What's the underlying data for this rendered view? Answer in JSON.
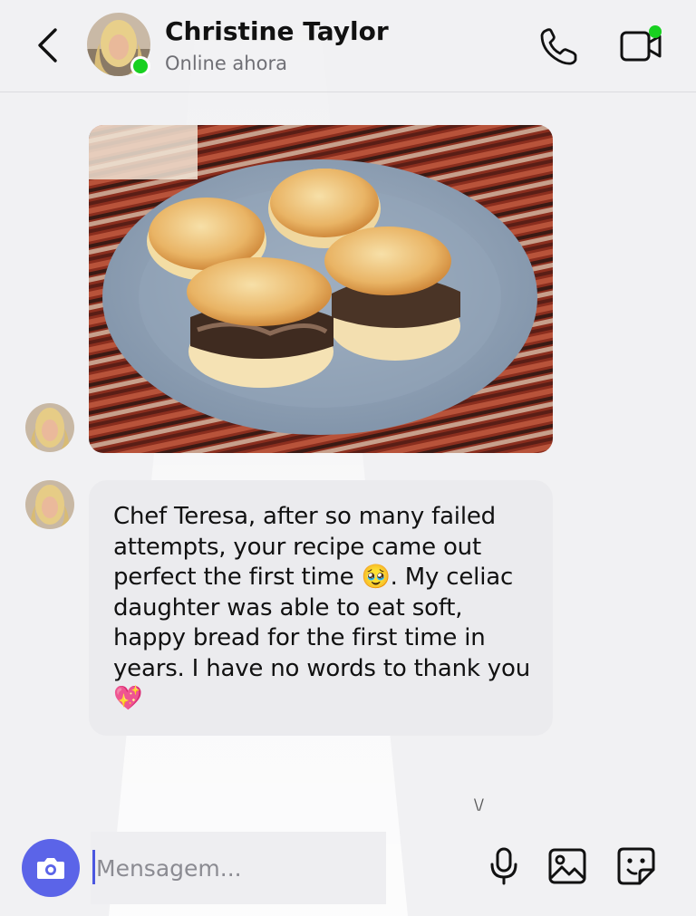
{
  "header": {
    "contact_name": "Christine Taylor",
    "status": "Online ahora",
    "online": true,
    "accent_online": "#18d020"
  },
  "icons": {
    "back": "chevron-left-icon",
    "call": "phone-icon",
    "video": "video-camera-icon",
    "camera": "camera-icon",
    "mic": "microphone-icon",
    "gallery": "image-icon",
    "sticker": "sticker-icon"
  },
  "messages": [
    {
      "type": "image",
      "alt": ""
    },
    {
      "type": "text",
      "text": "Chef Teresa, after so many failed attempts, your recipe came out perfect the first time 🥹. My celiac daughter was able to eat soft, happy bread for the first time in years. I have no words to thank you 💖"
    }
  ],
  "composer": {
    "placeholder": "Mensagem...",
    "value": ""
  },
  "colors": {
    "background": "#f1f1f3",
    "bubble": "#ebebee",
    "camera_button": "#5b64e8",
    "text": "#111111"
  }
}
